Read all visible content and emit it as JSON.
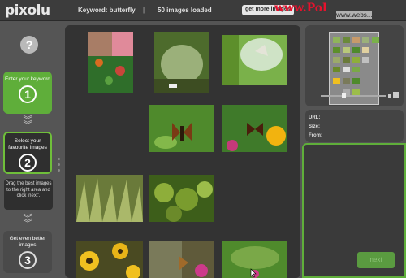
{
  "header": {
    "logo": "pixolu",
    "keyword": "Keyword: butterfly",
    "separator": "|",
    "loaded": "50 images loaded",
    "get_more": "get more images",
    "watermark": "www.Pol",
    "watermark2": "www.webs..."
  },
  "sidebar": {
    "help": "?",
    "step1_label": "Enter your keyword",
    "step1_num": "1",
    "step2_label": "Select your favourite images",
    "step2_num": "2",
    "hint": "Drag the best images to the right area and click 'next'.",
    "step3_label": "Get even better images",
    "step3_num": "3"
  },
  "info": {
    "url_label": "URL:",
    "size_label": "Size:",
    "from_label": "From:"
  },
  "actions": {
    "next": "next"
  },
  "colors": {
    "accent_green": "#5fae3a",
    "panel_dark": "#333333",
    "background": "#555555"
  }
}
